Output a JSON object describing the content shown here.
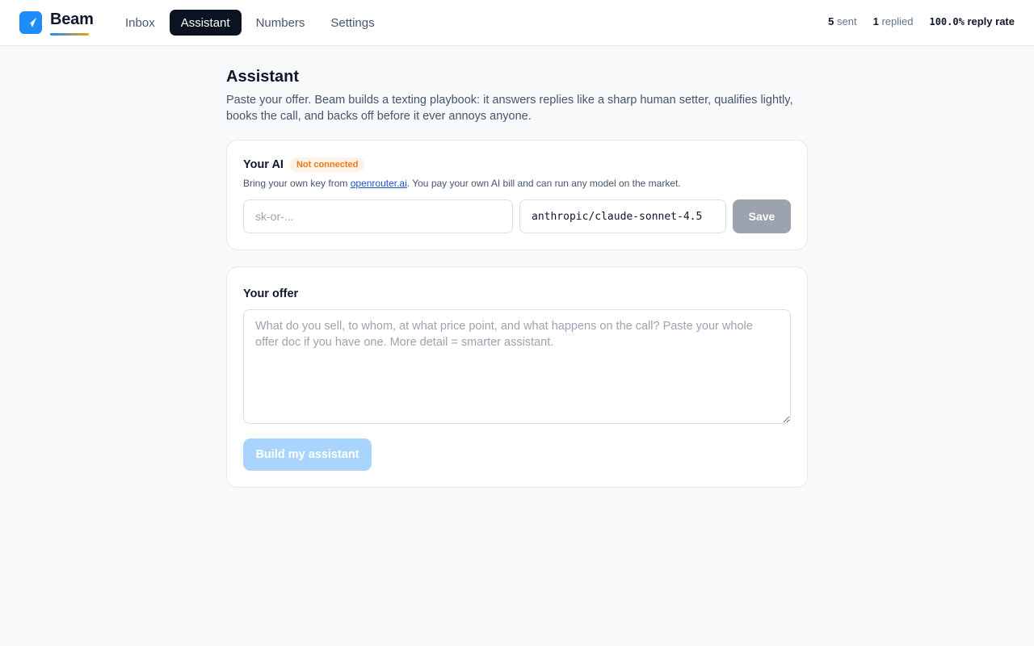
{
  "app": {
    "name": "Beam",
    "logo_icon": "paper-plane-icon",
    "accent_color": "#1d8cf8"
  },
  "nav": {
    "items": [
      {
        "label": "Inbox",
        "active": false
      },
      {
        "label": "Assistant",
        "active": true
      },
      {
        "label": "Numbers",
        "active": false
      },
      {
        "label": "Settings",
        "active": false
      }
    ]
  },
  "stats": {
    "sent_count": "5",
    "sent_label": "sent",
    "replied_count": "1",
    "replied_label": "replied",
    "reply_rate_value": "100.0%",
    "reply_rate_label": "reply rate"
  },
  "page": {
    "title": "Assistant",
    "description": "Paste your offer. Beam builds a texting playbook: it answers replies like a sharp human setter, qualifies lightly, books the call, and backs off before it ever annoys anyone."
  },
  "ai_card": {
    "title": "Your AI",
    "status_badge": "Not connected",
    "status_color": "#ea7a1a",
    "subtitle_prefix": "Bring your own key from ",
    "subtitle_link": "openrouter.ai",
    "subtitle_suffix": ". You pay your own AI bill and can run any model on the market.",
    "key_placeholder": "sk-or-...",
    "key_value": "",
    "model_value": "anthropic/claude-sonnet-4.5",
    "save_label": "Save"
  },
  "offer_card": {
    "title": "Your offer",
    "placeholder": "What do you sell, to whom, at what price point, and what happens on the call? Paste your whole offer doc if you have one. More detail = smarter assistant.",
    "value": "",
    "build_label": "Build my assistant"
  }
}
